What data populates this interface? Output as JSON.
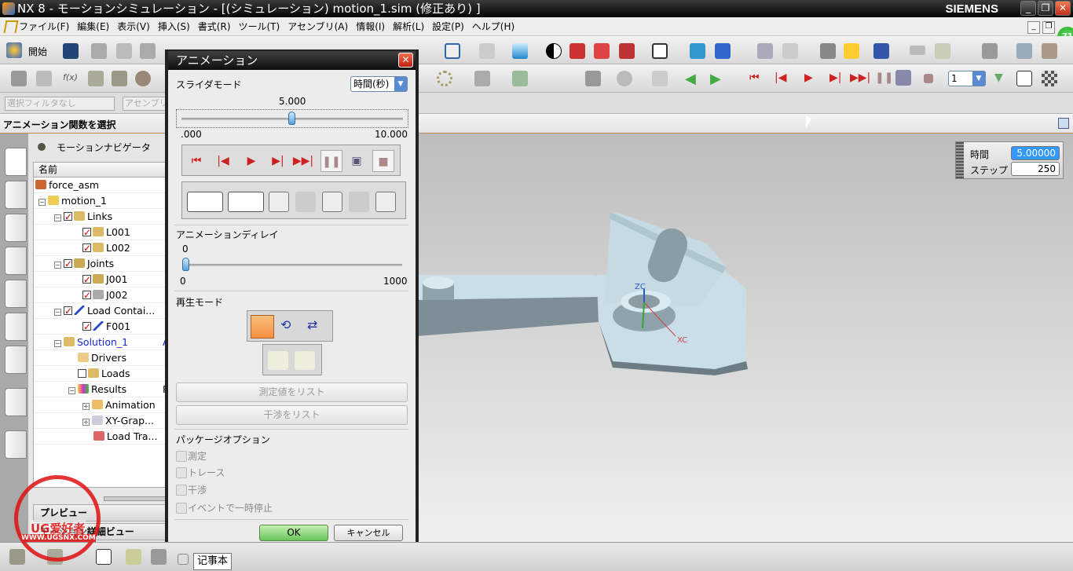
{
  "window": {
    "title": "NX 8 - モーションシミュレーション - [(シミュレーション) motion_1.sim (修正あり) ]",
    "brand": "SIEMENS",
    "minimize": "_",
    "restore": "❐",
    "close": "✕"
  },
  "menu": [
    "ファイル(F)",
    "編集(E)",
    "表示(V)",
    "挿入(S)",
    "書式(R)",
    "ツール(T)",
    "アセンブリ(A)",
    "情報(I)",
    "解析(L)",
    "設定(P)",
    "ヘルプ(H)"
  ],
  "toolbar": {
    "start_label": "開始",
    "selection_filter": "選択フィルタなし",
    "assembly_filter": "アセンブリ",
    "frame_value": "1",
    "badge": "71",
    "strip_title": "アニメーション関数を選択"
  },
  "navigator": {
    "title": "モーションナビゲータ",
    "column_name": "名前",
    "col2_peek": [
      "A",
      "R"
    ],
    "items": [
      {
        "label": "force_asm"
      },
      {
        "label": "motion_1"
      },
      {
        "label": "Links"
      },
      {
        "label": "L001"
      },
      {
        "label": "L002"
      },
      {
        "label": "Joints"
      },
      {
        "label": "J001"
      },
      {
        "label": "J002"
      },
      {
        "label": "Load Contai..."
      },
      {
        "label": "F001"
      },
      {
        "label": "Solution_1"
      },
      {
        "label": "Drivers"
      },
      {
        "label": "Loads"
      },
      {
        "label": "Results"
      },
      {
        "label": "Animation"
      },
      {
        "label": "XY-Grap..."
      },
      {
        "label": "Load Tra..."
      }
    ],
    "preview": "プレビュー",
    "detail": "モーション詳細ビュー"
  },
  "dialog": {
    "title": "アニメーション",
    "slider_mode_label": "スライダモード",
    "slider_mode_value": "時間(秒)",
    "time_value": "5.000",
    "time_fraction": 0.5,
    "time_min": ".000",
    "time_max": "10.000",
    "delay_label": "アニメーションディレイ",
    "delay_value": "0",
    "delay_min": "0",
    "delay_max": "1000",
    "playback_mode_label": "再生モード",
    "list_measures": "測定値をリスト",
    "list_interference": "干渉をリスト",
    "package_options_label": "パッケージオプション",
    "options": [
      "測定",
      "トレース",
      "干渉",
      "イベントで一時停止"
    ],
    "ok": "OK",
    "cancel": "キャンセル"
  },
  "readout": {
    "time_label": "時間",
    "time_value": "5.00000",
    "step_label": "ステップ",
    "step_value": "250"
  },
  "viewport": {
    "zc": "ZC",
    "xc": "XC"
  },
  "tooltip": "记事本",
  "watermark": {
    "text": "UG爱好者",
    "url": "WWW.UGSNX.COM"
  },
  "colors": {
    "accent": "#3a8de0",
    "selection": "#3399ff",
    "ok_green": "#7ed06a",
    "part": "#c8dde6"
  }
}
